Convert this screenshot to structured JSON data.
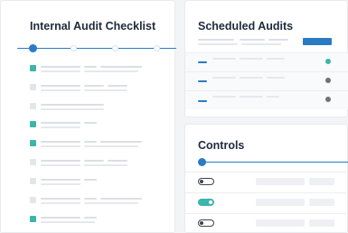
{
  "checklist": {
    "title": "Internal Audit Checklist",
    "items": [
      {
        "checked": true
      },
      {
        "checked": false
      },
      {
        "checked": false
      },
      {
        "checked": true
      },
      {
        "checked": true
      },
      {
        "checked": false
      },
      {
        "checked": false
      },
      {
        "checked": false
      },
      {
        "checked": true
      }
    ]
  },
  "scheduled": {
    "title": "Scheduled Audits",
    "rows": [
      {
        "status_color": "#3cb5aa"
      },
      {
        "status_color": "#6e737a"
      },
      {
        "status_color": "#6e737a"
      }
    ]
  },
  "controls": {
    "title": "Controls",
    "toggles": [
      {
        "on": false
      },
      {
        "on": true
      },
      {
        "on": false
      }
    ]
  },
  "colors": {
    "accent": "#2b7bc4",
    "teal": "#3cb5aa",
    "title_text": "#1e2b3c"
  }
}
